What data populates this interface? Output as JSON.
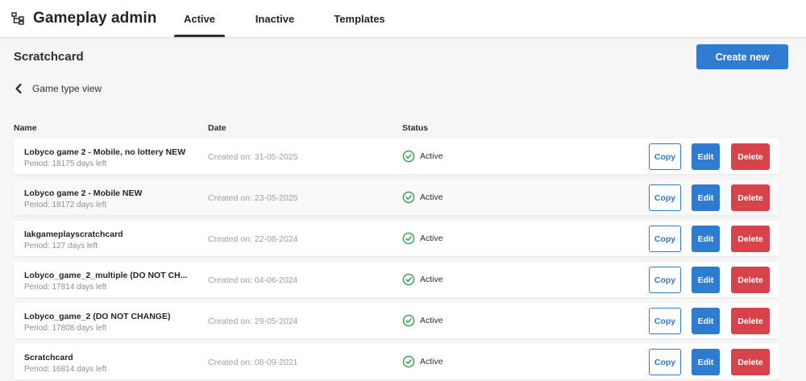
{
  "header": {
    "title": "Gameplay admin",
    "icon": "hierarchy-icon",
    "tabs": [
      {
        "label": "Active",
        "active": true
      },
      {
        "label": "Inactive",
        "active": false
      },
      {
        "label": "Templates",
        "active": false
      }
    ]
  },
  "page": {
    "title": "Scratchcard",
    "create_label": "Create new",
    "back_label": "Game type view"
  },
  "columns": {
    "name": "Name",
    "date": "Date",
    "status": "Status"
  },
  "games": [
    {
      "name": "Lobyco game 2 - Mobile, no lottery NEW",
      "period": "Period: 18175 days left",
      "date": "Created on: 31-05-2025",
      "status": "Active"
    },
    {
      "name": "Lobyco game 2 - Mobile NEW",
      "period": "Period: 18172 days left",
      "date": "Created on: 23-05-2025",
      "status": "Active"
    },
    {
      "name": "Iakgameplayscratchcard",
      "period": "Period: 127 days left",
      "date": "Created on: 22-08-2024",
      "status": "Active"
    },
    {
      "name": "Lobyco_game_2_multiple (DO NOT CH...",
      "period": "Period: 17814 days left",
      "date": "Created on: 04-06-2024",
      "status": "Active"
    },
    {
      "name": "Lobyco_game_2 (DO NOT CHANGE)",
      "period": "Period: 17808 days left",
      "date": "Created on: 29-05-2024",
      "status": "Active"
    },
    {
      "name": "Scratchcard",
      "period": "Period: 16814 days left",
      "date": "Created on: 08-09-2021",
      "status": "Active"
    }
  ],
  "actions": {
    "copy": "Copy",
    "edit": "Edit",
    "delete": "Delete"
  },
  "colors": {
    "primary": "#2f7bd0",
    "danger": "#d8424a",
    "success": "#2e9d4a"
  }
}
